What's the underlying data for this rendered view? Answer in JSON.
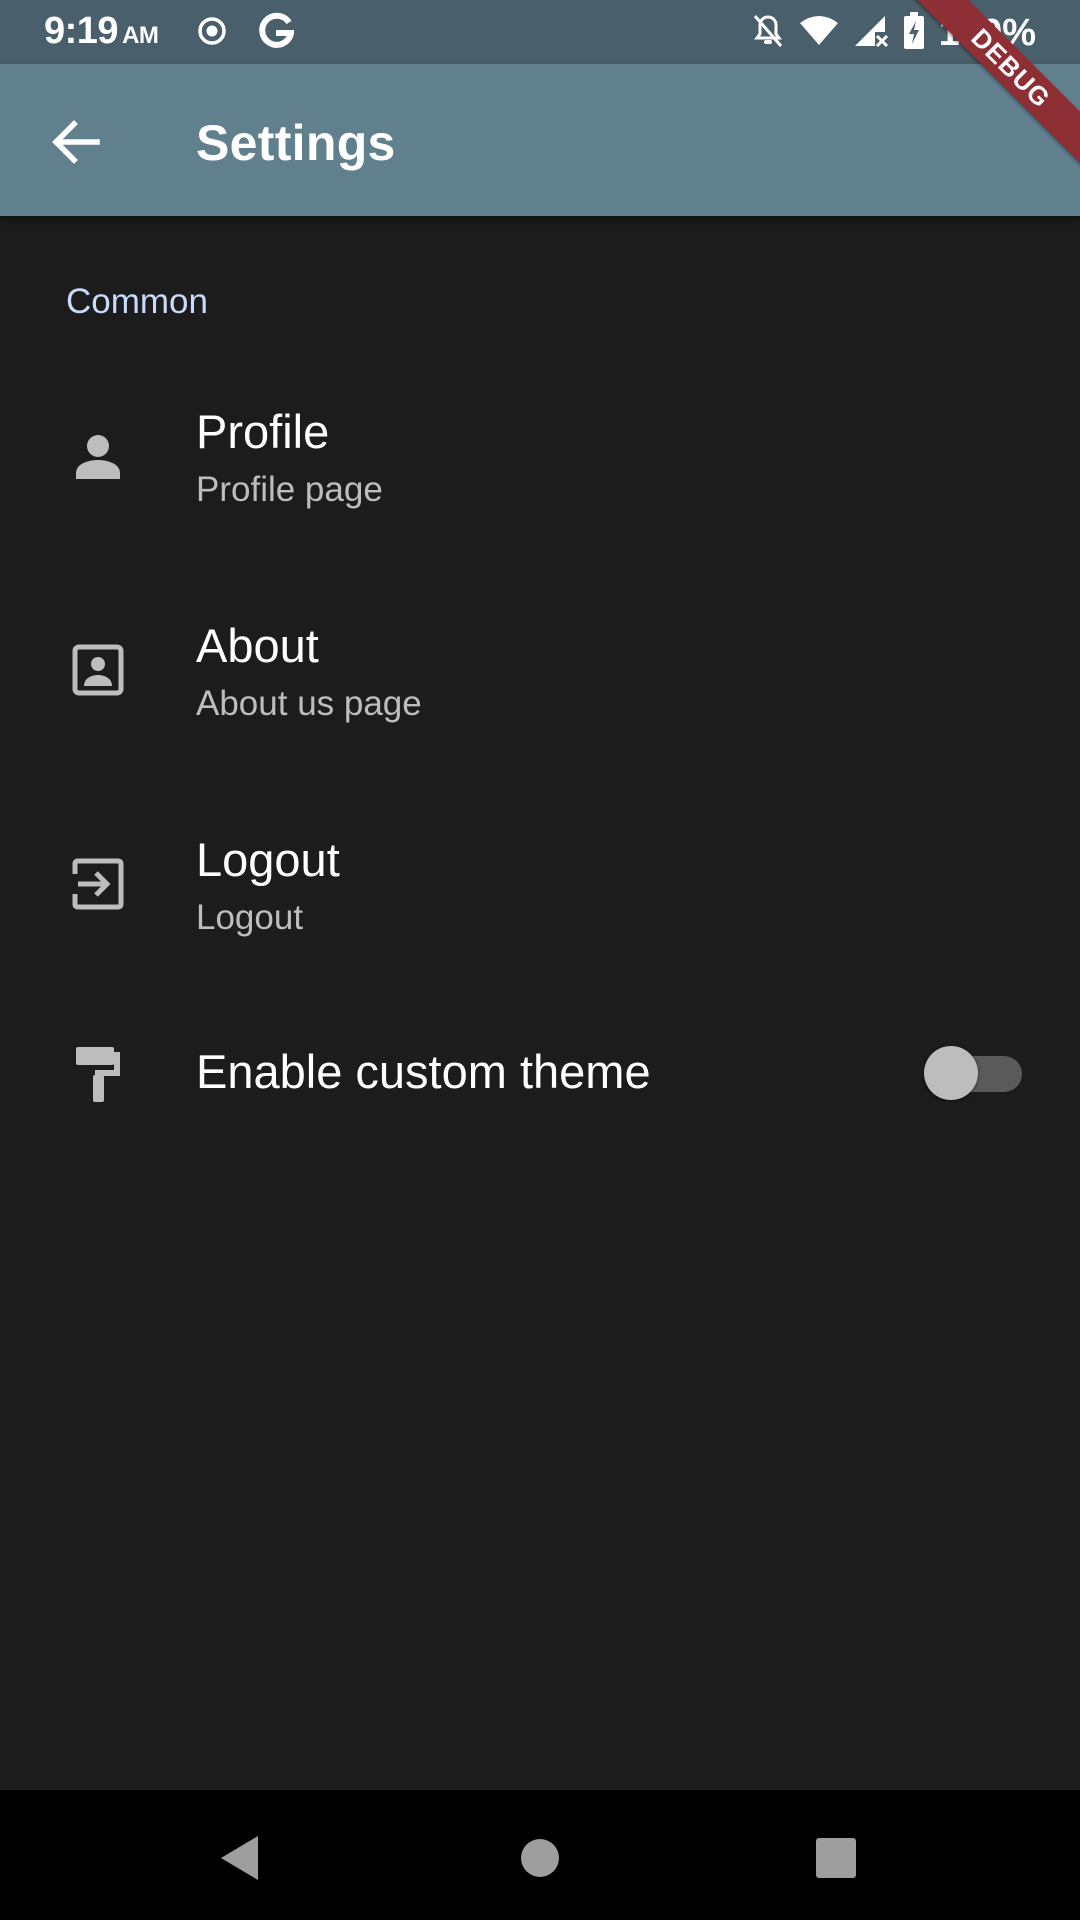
{
  "status_bar": {
    "time": "9:19",
    "ampm": "AM",
    "battery": "100%",
    "icons": [
      "radio-icon",
      "google-icon",
      "notifications-off-icon",
      "wifi-icon",
      "signal-icon",
      "battery-charging-icon"
    ]
  },
  "app_bar": {
    "title": "Settings",
    "back_icon": "arrow-back-icon",
    "color": "#61808e"
  },
  "debug_banner": {
    "label": "DEBUG"
  },
  "sections": [
    {
      "title": "Common",
      "tiles": [
        {
          "title": "Profile",
          "subtitle": "Profile page",
          "icon": "person-icon"
        },
        {
          "title": "About",
          "subtitle": "About us page",
          "icon": "contact-portrait-icon"
        },
        {
          "title": "Logout",
          "subtitle": "Logout",
          "icon": "logout-icon"
        },
        {
          "title": "Enable custom theme",
          "icon": "format-paint-icon",
          "switch_on": false
        }
      ]
    }
  ],
  "nav_bar": {
    "buttons": [
      "back-triangle-icon",
      "home-circle-icon",
      "recents-square-icon"
    ]
  },
  "colors": {
    "background": "#1c1c1c",
    "status_bar": "#4a5f6c",
    "section_title": "#c7dbfb",
    "debug": "#8e2f36"
  }
}
